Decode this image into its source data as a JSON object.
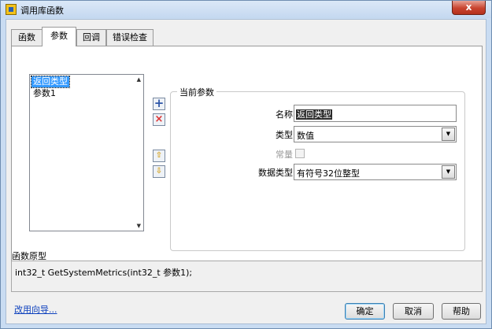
{
  "window": {
    "title": "调用库函数",
    "close_symbol": "x",
    "icon": "labview-app-icon"
  },
  "tabs": [
    {
      "label": "函数",
      "active": false
    },
    {
      "label": "参数",
      "active": true
    },
    {
      "label": "回调",
      "active": false
    },
    {
      "label": "错误检查",
      "active": false
    }
  ],
  "param_list": {
    "items": [
      "返回类型",
      "参数1"
    ],
    "selected_index": 0
  },
  "side_buttons": {
    "add": "+",
    "delete": "×",
    "move_up": "⇧",
    "move_down": "⇩"
  },
  "current_param": {
    "group_title": "当前参数",
    "name_label": "名称",
    "name_value": "返回类型",
    "type_label": "类型",
    "type_value": "数值",
    "constant_label": "常量",
    "constant_checked": false,
    "data_type_label": "数据类型",
    "data_type_value": "有符号32位整型"
  },
  "prototype": {
    "label": "函数原型",
    "text": "int32_t GetSystemMetrics(int32_t 参数1);"
  },
  "footer": {
    "wizard_link": "改用向导...",
    "ok_label": "确定",
    "cancel_label": "取消",
    "help_label": "帮助"
  },
  "colors": {
    "selection": "#3399ff",
    "close_button": "#c8442f",
    "link": "#0b3fbd"
  }
}
